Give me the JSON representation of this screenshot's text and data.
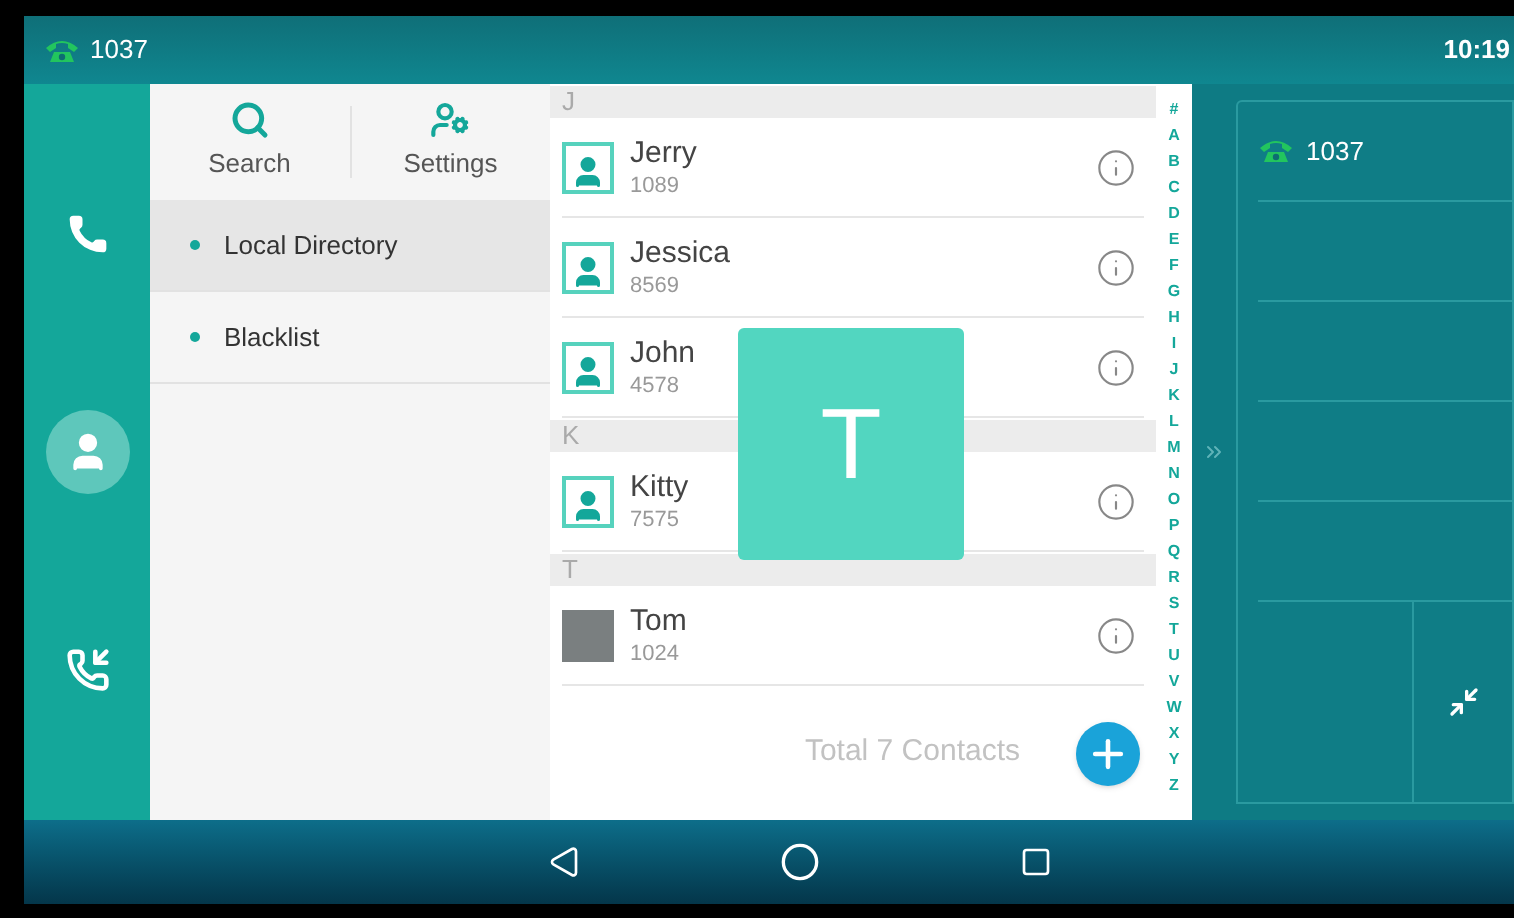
{
  "status_bar": {
    "line": "1037",
    "time": "10:19"
  },
  "rail": [
    {
      "kind": "phone",
      "selected": false
    },
    {
      "kind": "contacts",
      "selected": true
    },
    {
      "kind": "history",
      "selected": false
    }
  ],
  "menu": {
    "actions": [
      {
        "kind": "search",
        "label": "Search"
      },
      {
        "kind": "settings",
        "label": "Settings"
      }
    ],
    "items": [
      {
        "label": "Local Directory",
        "selected": true
      },
      {
        "label": "Blacklist",
        "selected": false
      }
    ]
  },
  "contacts": {
    "groups": [
      {
        "letter": "J",
        "contacts": [
          {
            "name": "Jerry",
            "number": "1089",
            "kind": "default"
          },
          {
            "name": "Jessica",
            "number": "8569",
            "kind": "default"
          },
          {
            "name": "John",
            "number": "4578",
            "kind": "default"
          }
        ]
      },
      {
        "letter": "K",
        "contacts": [
          {
            "name": "Kitty",
            "number": "7575",
            "kind": "default"
          }
        ]
      },
      {
        "letter": "T",
        "contacts": [
          {
            "name": "Tom",
            "number": "1024",
            "kind": "photo"
          }
        ]
      }
    ],
    "footer": "Total 7 Contacts",
    "overlay_letter": "T",
    "index": [
      "#",
      "A",
      "B",
      "C",
      "D",
      "E",
      "F",
      "G",
      "H",
      "I",
      "J",
      "K",
      "L",
      "M",
      "N",
      "O",
      "P",
      "Q",
      "R",
      "S",
      "T",
      "U",
      "V",
      "W",
      "X",
      "Y",
      "Z"
    ]
  },
  "line_panel": {
    "line": "1037"
  }
}
